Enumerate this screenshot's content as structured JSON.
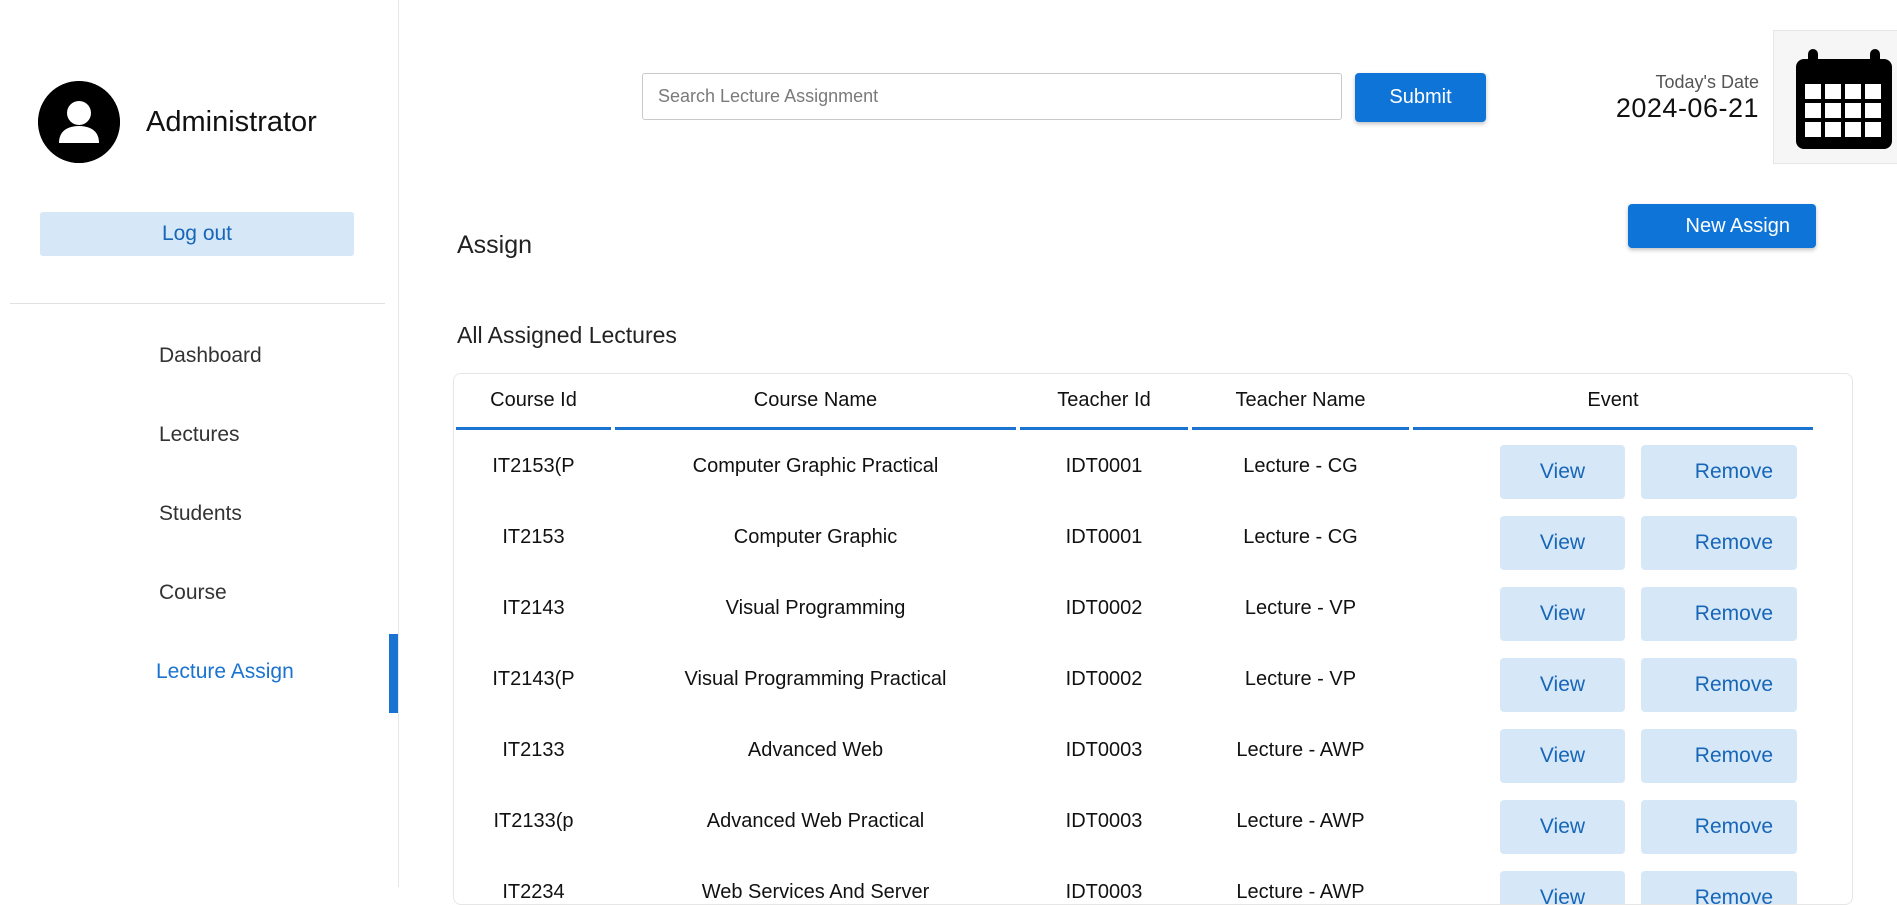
{
  "sidebar": {
    "role": "Administrator",
    "logout_label": "Log out",
    "nav": [
      {
        "label": "Dashboard",
        "active": false
      },
      {
        "label": "Lectures",
        "active": false
      },
      {
        "label": "Students",
        "active": false
      },
      {
        "label": "Course",
        "active": false
      },
      {
        "label": "Lecture Assign",
        "active": true
      }
    ]
  },
  "header": {
    "search_placeholder": "Search Lecture Assignment",
    "submit_label": "Submit",
    "date_label": "Today's Date",
    "date_value": "2024-06-21"
  },
  "main": {
    "page_title": "Assign",
    "new_assign_label": "New Assign",
    "section_title": "All Assigned Lectures",
    "columns": [
      "Course Id",
      "Course Name",
      "Teacher Id",
      "Teacher Name",
      "Event"
    ],
    "view_label": "View",
    "remove_label": "Remove",
    "rows": [
      {
        "course_id": "IT2153(P",
        "course_name": "Computer Graphic Practical",
        "teacher_id": "IDT0001",
        "teacher_name": "Lecture - CG"
      },
      {
        "course_id": "IT2153",
        "course_name": "Computer Graphic",
        "teacher_id": "IDT0001",
        "teacher_name": "Lecture - CG"
      },
      {
        "course_id": "IT2143",
        "course_name": "Visual Programming",
        "teacher_id": "IDT0002",
        "teacher_name": "Lecture - VP"
      },
      {
        "course_id": "IT2143(P",
        "course_name": "Visual Programming Practical",
        "teacher_id": "IDT0002",
        "teacher_name": "Lecture - VP"
      },
      {
        "course_id": "IT2133",
        "course_name": "Advanced Web",
        "teacher_id": "IDT0003",
        "teacher_name": "Lecture - AWP"
      },
      {
        "course_id": "IT2133(p",
        "course_name": "Advanced Web Practical",
        "teacher_id": "IDT0003",
        "teacher_name": "Lecture - AWP"
      },
      {
        "course_id": "IT2234",
        "course_name": "Web Services And Server",
        "teacher_id": "IDT0003",
        "teacher_name": "Lecture - AWP"
      }
    ]
  },
  "colors": {
    "accent": "#1a73d1",
    "button_primary": "#0e74d8",
    "button_light_bg": "#d6e8f7",
    "button_light_text": "#1766b8"
  },
  "icons": {
    "avatar": "user-avatar-icon",
    "calendar": "calendar-icon"
  }
}
